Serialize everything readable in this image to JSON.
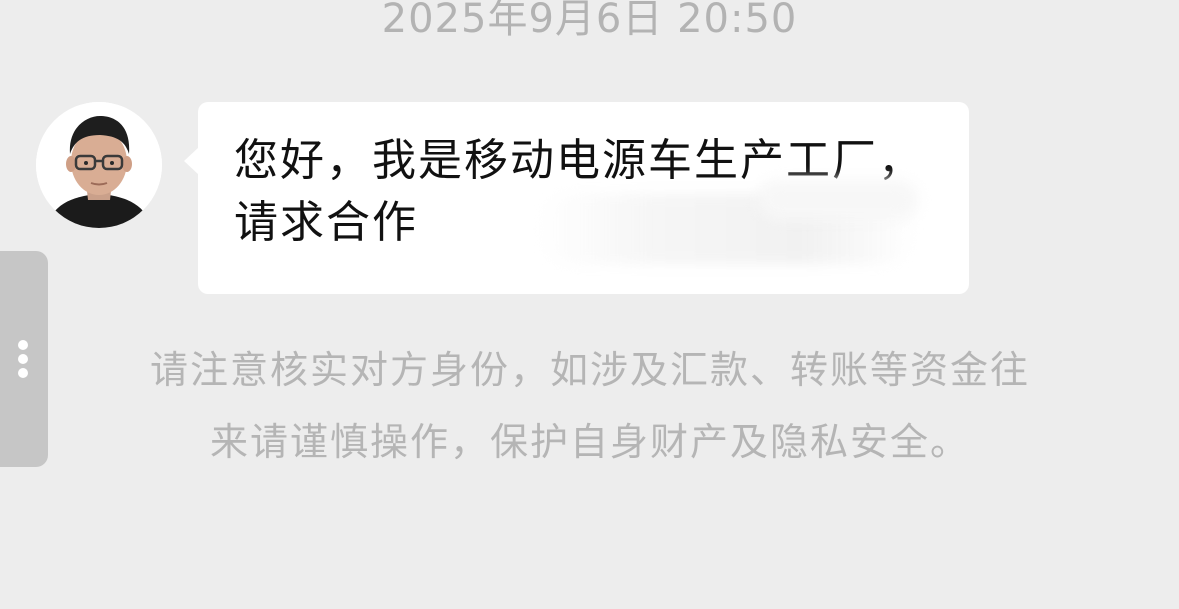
{
  "timestamp": "2025年9月6日 20:50",
  "message": {
    "sender_avatar": "avatar-photo-man-glasses",
    "text": "您好，我是移动电源车生产工厂，请求合作",
    "redacted": true
  },
  "side_handle": {
    "icon": "more-vertical-icon"
  },
  "notice": {
    "line1": "请注意核实对方身份，如涉及汇款、转账等资金往",
    "line2": "来请谨慎操作，保护自身财产及隐私安全。"
  },
  "colors": {
    "background": "#ededed",
    "bubble": "#ffffff",
    "muted_text": "#b5b5b5",
    "message_text": "#111111",
    "handle": "#c6c6c6"
  }
}
